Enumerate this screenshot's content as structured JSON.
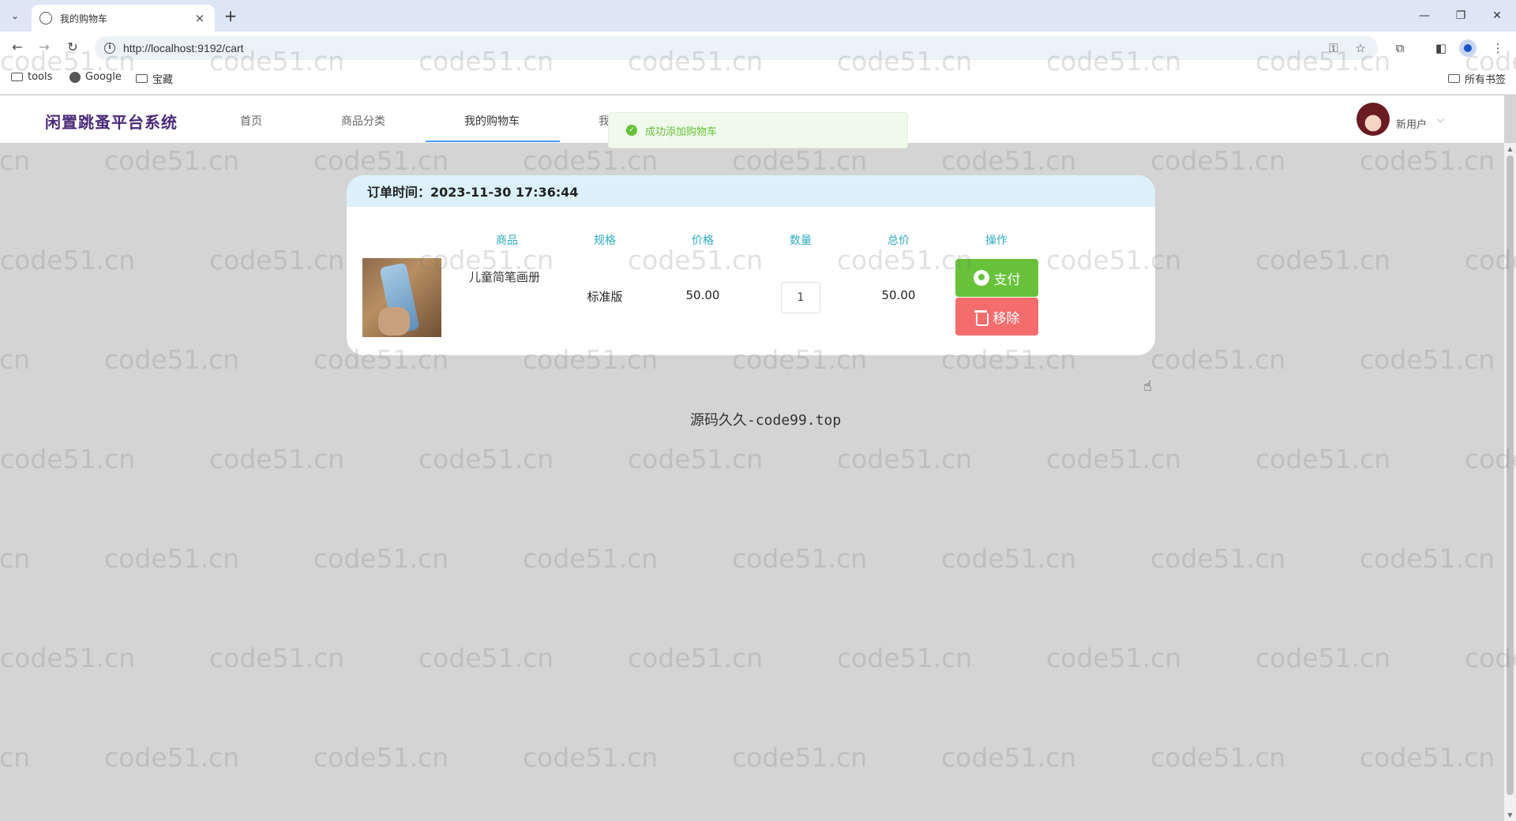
{
  "browser": {
    "tab_title": "我的购物车",
    "url": "http://localhost:9192/cart",
    "bookmarks": [
      "tools",
      "Google",
      "宝藏"
    ],
    "all_bookmarks": "所有书签"
  },
  "header": {
    "logo": "闲置跳蚤平台系统",
    "nav": [
      "首页",
      "商品分类",
      "我的购物车",
      "我"
    ],
    "active_nav": "我的购物车",
    "user_name": "新用户"
  },
  "toast": {
    "message": "成功添加购物车",
    "type": "success"
  },
  "cart": {
    "order_time_label": "订单时间：2023-11-30 17:36:44",
    "columns": [
      "商品",
      "规格",
      "价格",
      "数量",
      "总价",
      "操作"
    ],
    "items": [
      {
        "name": "儿童简笔画册",
        "spec": "标准版",
        "price": "50.00",
        "quantity": "1",
        "total": "50.00"
      }
    ],
    "pay_label": "支付",
    "remove_label": "移除"
  },
  "footer": {
    "text": "源码久久-code99.top"
  },
  "watermark": "code51.cn",
  "colors": {
    "accent": "#409eff",
    "pay": "#67c23a",
    "remove": "#f56c6c",
    "column_header": "#2eaac4",
    "logo": "#4b2a7a"
  }
}
